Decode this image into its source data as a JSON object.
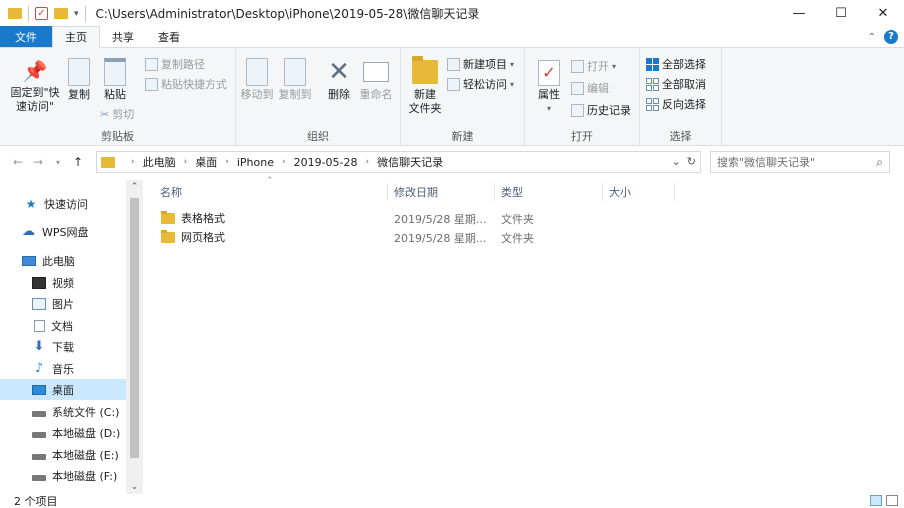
{
  "window": {
    "path": "C:\\Users\\Administrator\\Desktop\\iPhone\\2019-05-28\\微信聊天记录",
    "minimize": "—",
    "maximize": "☐",
    "close": "✕"
  },
  "tabs": [
    "文件",
    "主页",
    "共享",
    "查看"
  ],
  "ribbon": {
    "clipboard": {
      "label": "剪贴板",
      "pin": "固定到\"快\n速访问\"",
      "copy": "复制",
      "paste": "粘贴",
      "copy_path": "复制路径",
      "paste_shortcut": "粘贴快捷方式",
      "cut": "剪切"
    },
    "organize": {
      "label": "组织",
      "move_to": "移动到",
      "copy_to": "复制到",
      "delete": "删除",
      "rename": "重命名"
    },
    "new": {
      "label": "新建",
      "new_folder": "新建\n文件夹",
      "new_item": "新建项目",
      "easy_access": "轻松访问"
    },
    "open": {
      "label": "打开",
      "properties": "属性",
      "open": "打开",
      "edit": "编辑",
      "history": "历史记录"
    },
    "select": {
      "label": "选择",
      "select_all": "全部选择",
      "select_none": "全部取消",
      "invert": "反向选择"
    }
  },
  "address": {
    "crumbs": [
      "此电脑",
      "桌面",
      "iPhone",
      "2019-05-28",
      "微信聊天记录"
    ],
    "search_placeholder": "搜索\"微信聊天记录\""
  },
  "nav": {
    "items": [
      {
        "label": "快速访问",
        "icon": "star-icon"
      },
      {
        "label": "WPS网盘",
        "icon": "cloud-icon"
      },
      {
        "label": "此电脑",
        "icon": "computer-icon"
      },
      {
        "label": "视频",
        "icon": "video-icon"
      },
      {
        "label": "图片",
        "icon": "picture-icon"
      },
      {
        "label": "文档",
        "icon": "document-icon"
      },
      {
        "label": "下载",
        "icon": "download-icon"
      },
      {
        "label": "音乐",
        "icon": "music-icon"
      },
      {
        "label": "桌面",
        "icon": "desktop-icon"
      },
      {
        "label": "系统文件 (C:)",
        "icon": "drive-icon"
      },
      {
        "label": "本地磁盘 (D:)",
        "icon": "drive-icon"
      },
      {
        "label": "本地磁盘 (E:)",
        "icon": "drive-icon"
      },
      {
        "label": "本地磁盘 (F:)",
        "icon": "drive-icon"
      }
    ],
    "selected": "桌面"
  },
  "columns": [
    "名称",
    "修改日期",
    "类型",
    "大小"
  ],
  "files": [
    {
      "name": "表格格式",
      "date": "2019/5/28 星期...",
      "type": "文件夹"
    },
    {
      "name": "网页格式",
      "date": "2019/5/28 星期...",
      "type": "文件夹"
    }
  ],
  "status": {
    "count": "2 个项目"
  },
  "colors": {
    "accent": "#1979ca",
    "folder": "#e8b939",
    "selection": "#cce8ff"
  }
}
